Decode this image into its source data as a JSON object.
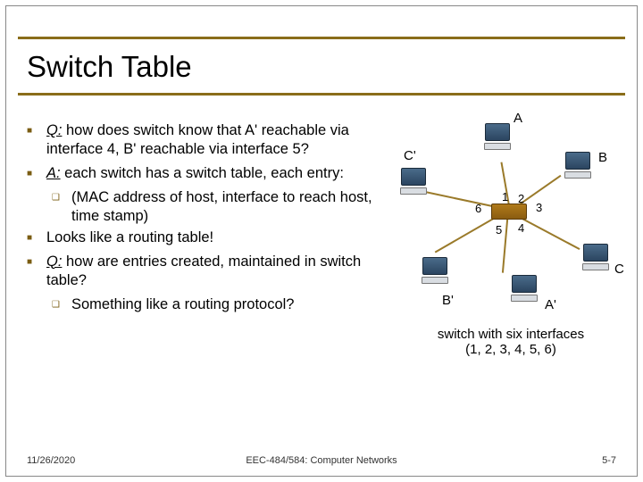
{
  "title": "Switch Table",
  "bullets": {
    "b1": "Q: how does switch know that A' reachable via interface 4, B' reachable via interface 5?",
    "b1_u": "Q:",
    "b1_rest": " how does switch know that A' reachable via interface 4, B' reachable via interface 5?",
    "b2_u": "A:",
    "b2_rest": "  each switch has a switch table, each entry:",
    "b2a": "(MAC address of host, interface to reach host, time stamp)",
    "b3": "Looks like a routing table!",
    "b4_u": "Q:",
    "b4_rest": " how are entries created, maintained in switch table?",
    "b4a": "Something like a routing protocol?"
  },
  "diagram": {
    "labels": {
      "A": "A",
      "B": "B",
      "C": "C",
      "Ap": "A'",
      "Bp": "B'",
      "Cp": "C'"
    },
    "ports": {
      "p1": "1",
      "p2": "2",
      "p3": "3",
      "p4": "4",
      "p5": "5",
      "p6": "6"
    },
    "caption_line1": "switch with six interfaces",
    "caption_line2": "(1, 2, 3, 4, 5, 6)"
  },
  "footer": {
    "date": "11/26/2020",
    "mid": "EEC-484/584: Computer Networks",
    "page": "5-7"
  }
}
